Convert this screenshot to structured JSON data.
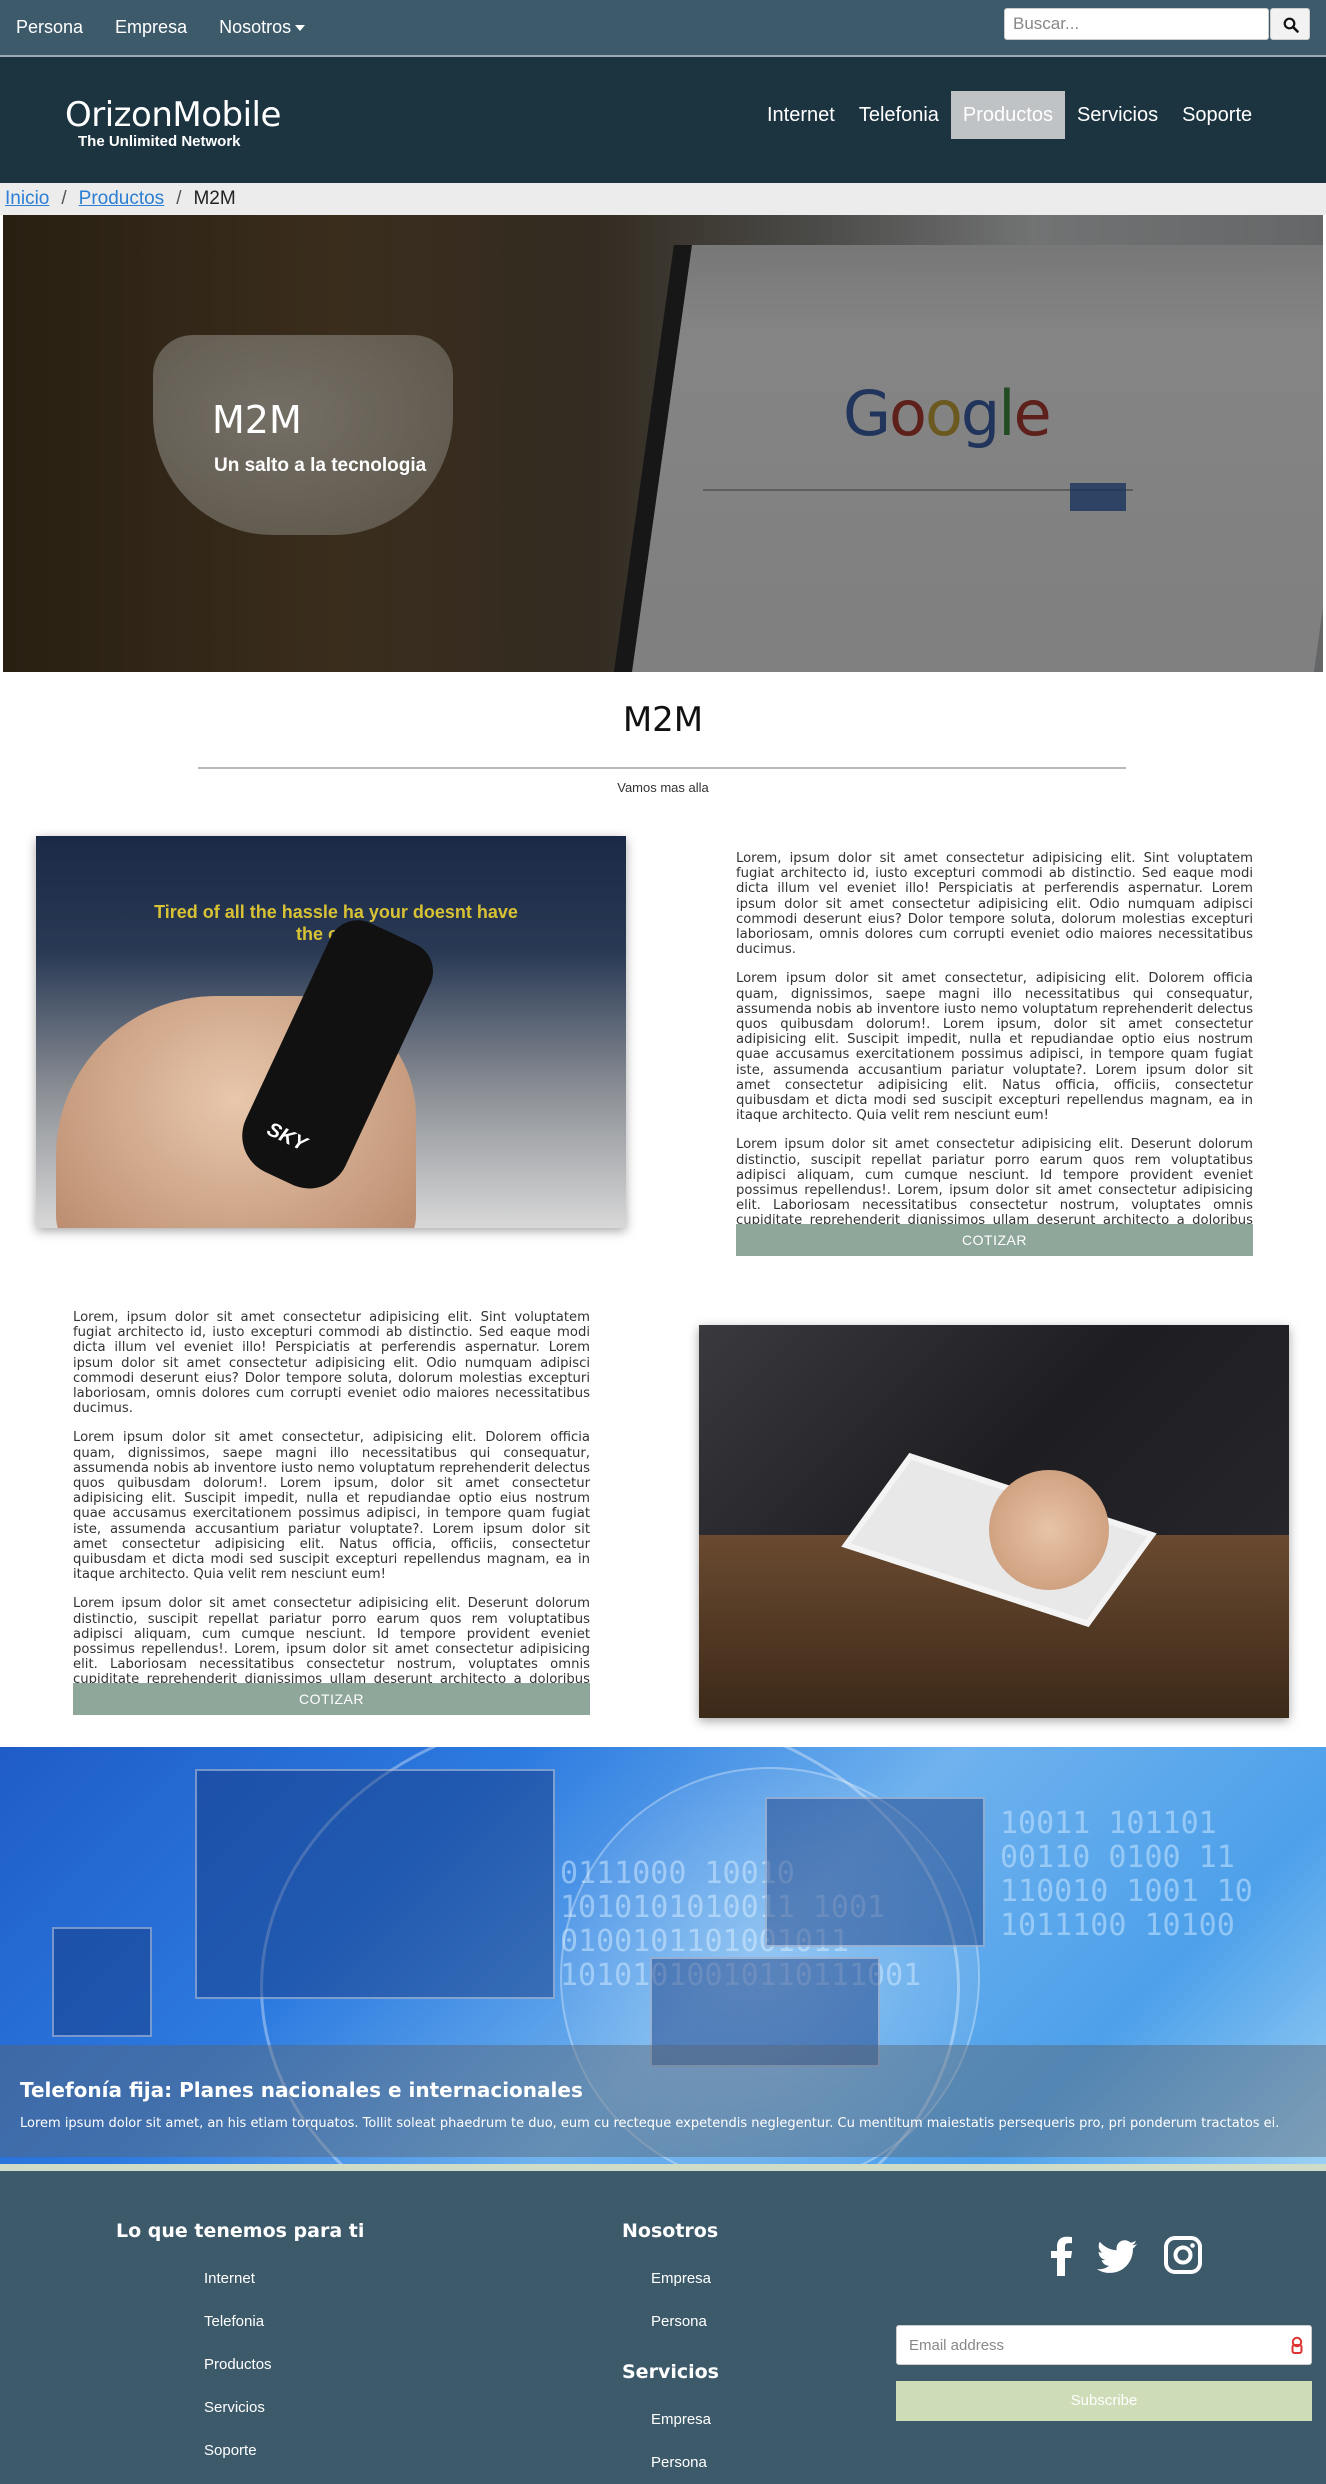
{
  "topbar": {
    "nav": [
      "Persona",
      "Empresa",
      "Nosotros"
    ],
    "search_placeholder": "Buscar..."
  },
  "header": {
    "logo_title": "OrizonMobile",
    "logo_subtitle": "The Unlimited Network",
    "nav": [
      {
        "label": "Internet",
        "active": false
      },
      {
        "label": "Telefonia",
        "active": false
      },
      {
        "label": "Productos",
        "active": true
      },
      {
        "label": "Servicios",
        "active": false
      },
      {
        "label": "Soporte",
        "active": false
      }
    ]
  },
  "breadcrumb": {
    "items": [
      "Inicio",
      "Productos",
      "M2M"
    ]
  },
  "hero": {
    "title": "M2M",
    "subtitle": "Un salto a la tecnologia",
    "screen_logo": "Google",
    "tv_text": "Tired of all the hassle ha your doesnt have the cloud",
    "remote_brand": "SKY"
  },
  "section": {
    "title": "M2M",
    "subtitle": "Vamos mas alla"
  },
  "content": {
    "paragraphs": [
      "Lorem, ipsum dolor sit amet consectetur adipisicing elit. Sint voluptatem fugiat architecto id, iusto excepturi commodi ab distinctio. Sed eaque modi dicta illum vel eveniet illo! Perspiciatis at perferendis aspernatur. Lorem ipsum dolor sit amet consectetur adipisicing elit. Odio numquam adipisci commodi deserunt eius? Dolor tempore soluta, dolorum molestias excepturi laboriosam, omnis dolores cum corrupti eveniet odio maiores necessitatibus ducimus.",
      "Lorem ipsum dolor sit amet consectetur, adipisicing elit. Dolorem officia quam, dignissimos, saepe magni illo necessitatibus qui consequatur, assumenda nobis ab inventore iusto nemo voluptatum reprehenderit delectus quos quibusdam dolorum!. Lorem ipsum, dolor sit amet consectetur adipisicing elit. Suscipit impedit, nulla et repudiandae optio eius nostrum quae accusamus exercitationem possimus adipisci, in tempore quam fugiat iste, assumenda accusantium pariatur voluptate?. Lorem ipsum dolor sit amet consectetur adipisicing elit. Natus officia, officiis, consectetur quibusdam et dicta modi sed suscipit excepturi repellendus magnam, ea in itaque architecto. Quia velit rem nesciunt eum!",
      "Lorem ipsum dolor sit amet consectetur adipisicing elit. Deserunt dolorum distinctio, suscipit repellat pariatur porro earum quos rem voluptatibus adipisci aliquam, cum cumque nesciunt. Id tempore provident eveniet possimus repellendus!. Lorem, ipsum dolor sit amet consectetur adipisicing elit. Laboriosam necessitatibus consectetur nostrum, voluptates omnis cupiditate reprehenderit dignissimos ullam deserunt architecto a doloribus recusandae illo ducimus veniam vitae, quod, expedita inventore."
    ],
    "cotizar_label": "COTIZAR"
  },
  "banner": {
    "title": "Telefonía fija: Planes nacionales e internacionales",
    "text": "Lorem ipsum dolor sit amet, an his etiam torquatos. Tollit soleat phaedrum te duo, eum cu recteque expetendis neglegentur. Cu mentitum maiestatis persequeris pro, pri ponderum tractatos ei."
  },
  "footer": {
    "col1_title": "Lo que tenemos para ti",
    "col1_links": [
      "Internet",
      "Telefonia",
      "Productos",
      "Servicios",
      "Soporte"
    ],
    "col2_title": "Nosotros",
    "col2_links": [
      "Empresa",
      "Persona"
    ],
    "col3_title": "Servicios",
    "col3_links": [
      "Empresa",
      "Persona"
    ],
    "social": [
      "facebook-icon",
      "twitter-icon",
      "instagram-icon"
    ],
    "email_placeholder": "Email address",
    "subscribe_label": "Subscribe"
  }
}
